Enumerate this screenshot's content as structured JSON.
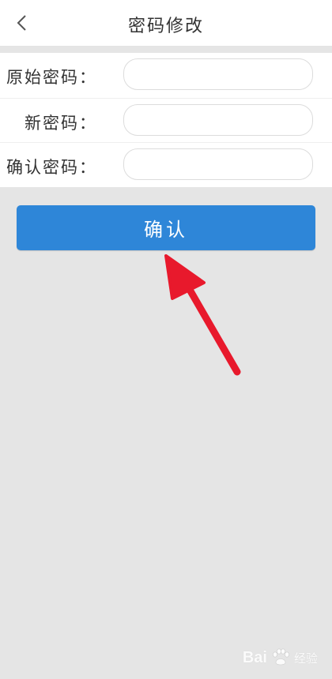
{
  "header": {
    "title": "密码修改",
    "back_icon": "chevron-left-icon"
  },
  "form": {
    "rows": [
      {
        "label": "原始密码：",
        "value": ""
      },
      {
        "label": "新密码：",
        "value": ""
      },
      {
        "label": "确认密码：",
        "value": ""
      }
    ]
  },
  "confirm_button": {
    "label": "确认",
    "color": "#2e86d8"
  },
  "annotation": {
    "arrow_color": "#e8192c"
  },
  "watermark": {
    "brand": "Bai",
    "suffix": "经验"
  }
}
